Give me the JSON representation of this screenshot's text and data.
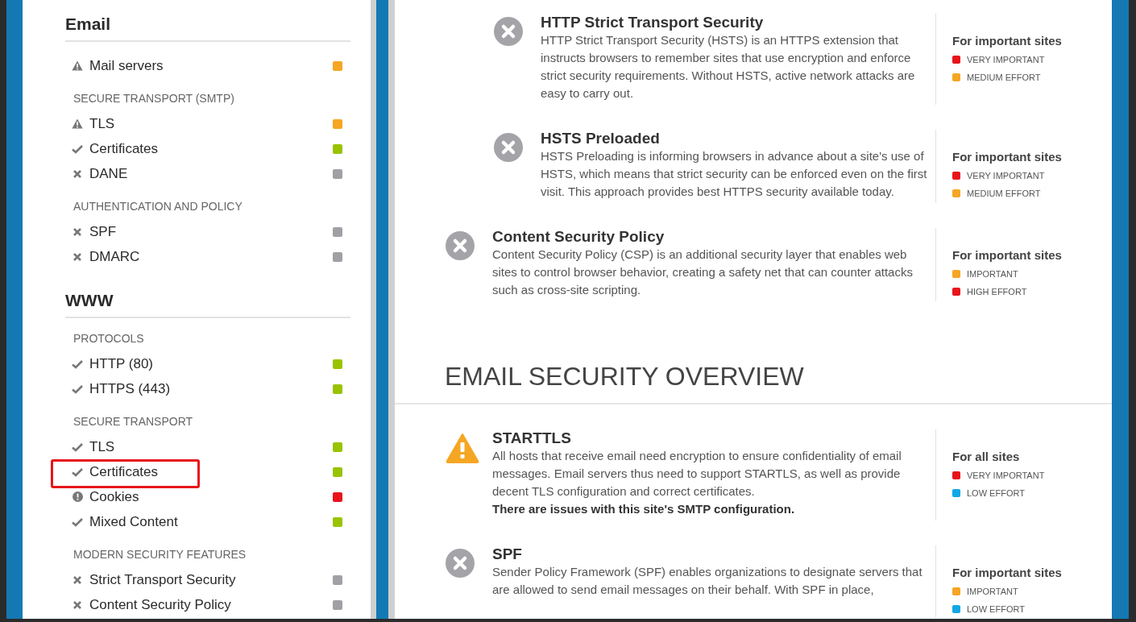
{
  "sidebar": {
    "sections": [
      {
        "title": "Email",
        "groups": [
          {
            "items": [
              {
                "label": "Mail servers",
                "kind": "warning",
                "color": "#f5a623",
                "highlighted": false
              }
            ]
          },
          {
            "label": "SECURE TRANSPORT (SMTP)",
            "items": [
              {
                "label": "TLS",
                "kind": "warning",
                "color": "#f5a623",
                "highlighted": false
              },
              {
                "label": "Certificates",
                "kind": "check",
                "color": "#99c300",
                "highlighted": false
              },
              {
                "label": "DANE",
                "kind": "cross",
                "color": "#a0a0a5",
                "highlighted": false
              }
            ]
          },
          {
            "label": "AUTHENTICATION AND POLICY",
            "items": [
              {
                "label": "SPF",
                "kind": "cross",
                "color": "#a0a0a5",
                "highlighted": false
              },
              {
                "label": "DMARC",
                "kind": "cross",
                "color": "#a0a0a5",
                "highlighted": false
              }
            ]
          }
        ]
      },
      {
        "title": "WWW",
        "groups": [
          {
            "label": "PROTOCOLS",
            "items": [
              {
                "label": "HTTP (80)",
                "kind": "check",
                "color": "#99c300",
                "highlighted": false
              },
              {
                "label": "HTTPS (443)",
                "kind": "check",
                "color": "#99c300",
                "highlighted": false
              }
            ]
          },
          {
            "label": "SECURE TRANSPORT",
            "items": [
              {
                "label": "TLS",
                "kind": "check",
                "color": "#99c300",
                "highlighted": false
              },
              {
                "label": "Certificates",
                "kind": "check",
                "color": "#99c300",
                "highlighted": true
              },
              {
                "label": "Cookies",
                "kind": "alert",
                "color": "#e8141a",
                "highlighted": false
              },
              {
                "label": "Mixed Content",
                "kind": "check",
                "color": "#99c300",
                "highlighted": false
              }
            ]
          },
          {
            "label": "MODERN SECURITY FEATURES",
            "items": [
              {
                "label": "Strict Transport Security",
                "kind": "cross",
                "color": "#a0a0a5",
                "highlighted": false
              },
              {
                "label": "Content Security Policy",
                "kind": "cross",
                "color": "#a0a0a5",
                "highlighted": false
              }
            ]
          }
        ]
      }
    ]
  },
  "main": {
    "sections": [
      {
        "items": [
          {
            "children": [
              {
                "title": "HTTP Strict Transport Security",
                "kind": "error",
                "description": "HTTP Strict Transport Security (HSTS) is an HTTPS extension that instructs browsers to remember sites that use encryption and enforce strict security requirements. Without HSTS, active network attacks are easy to carry out.",
                "audience": "For important sites",
                "tags": [
                  {
                    "label": "VERY IMPORTANT",
                    "color": "#e8141a"
                  },
                  {
                    "label": "MEDIUM EFFORT",
                    "color": "#f5a623"
                  }
                ]
              },
              {
                "title": "HSTS Preloaded",
                "kind": "error",
                "description": "HSTS Preloading is informing browsers in advance about a site's use of HSTS, which means that strict security can be enforced even on the first visit. This approach provides best HTTPS security available today.",
                "audience": "For important sites",
                "tags": [
                  {
                    "label": "VERY IMPORTANT",
                    "color": "#e8141a"
                  },
                  {
                    "label": "MEDIUM EFFORT",
                    "color": "#f5a623"
                  }
                ]
              }
            ]
          },
          {
            "title": "Content Security Policy",
            "kind": "error",
            "description": "Content Security Policy (CSP) is an additional security layer that enables web sites to control browser behavior, creating a safety net that can counter attacks such as cross-site scripting.",
            "audience": "For important sites",
            "tags": [
              {
                "label": "IMPORTANT",
                "color": "#f5a623"
              },
              {
                "label": "HIGH EFFORT",
                "color": "#e8141a"
              }
            ]
          }
        ]
      },
      {
        "title": "EMAIL SECURITY OVERVIEW",
        "items": [
          {
            "title": "STARTTLS",
            "kind": "warning",
            "description": "All hosts that receive email need encryption to ensure confidentiality of email messages. Email servers thus need to support STARTLS, as well as provide decent TLS configuration and correct certificates.",
            "note": "There are issues with this site's SMTP configuration.",
            "audience": "For all sites",
            "tags": [
              {
                "label": "VERY IMPORTANT",
                "color": "#e8141a"
              },
              {
                "label": "LOW EFFORT",
                "color": "#12a7e5"
              }
            ]
          },
          {
            "title": "SPF",
            "kind": "error",
            "description": "Sender Policy Framework (SPF) enables organizations to designate servers that are allowed to send email messages on their behalf. With SPF in place,",
            "audience": "For important sites",
            "tags": [
              {
                "label": "IMPORTANT",
                "color": "#f5a623"
              },
              {
                "label": "LOW EFFORT",
                "color": "#12a7e5"
              }
            ]
          }
        ]
      }
    ]
  }
}
